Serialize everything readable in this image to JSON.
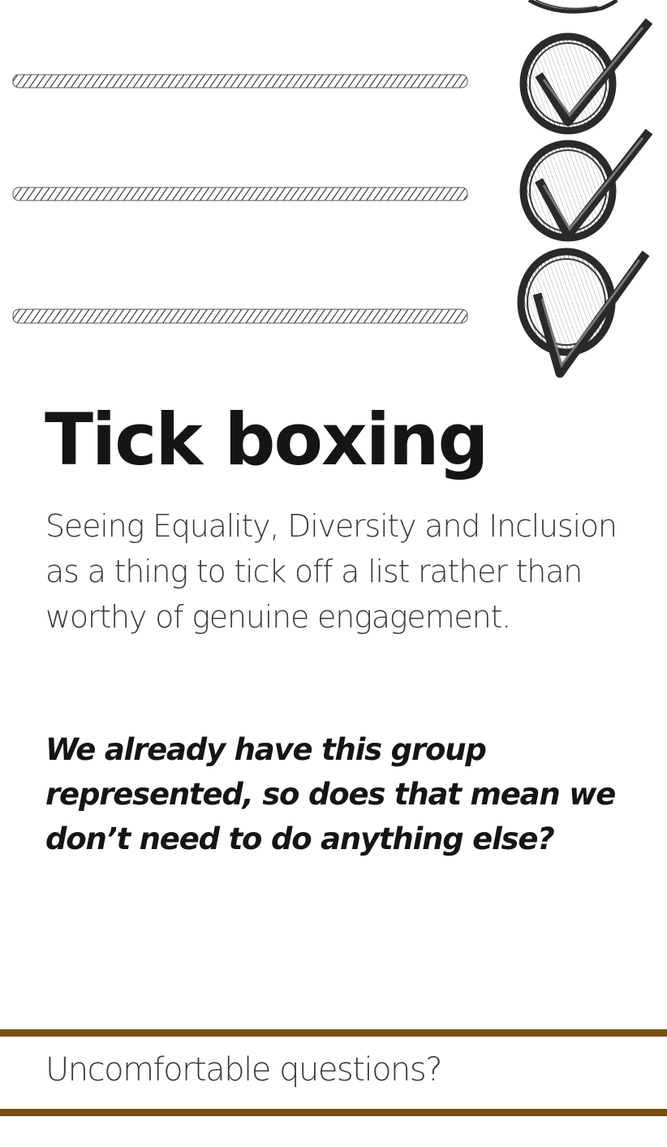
{
  "card": {
    "title": "Tick boxing",
    "description": "Seeing Equality, Diversity and Inclusion as a thing to tick off a list rather than worthy of genuine engagement.",
    "question": "We already have this group represented, so does that mean we don’t need to do anything else?",
    "footer": "Uncomfortable questions?"
  },
  "illustration": {
    "icons": [
      "hatched-line-icon",
      "checked-circle-icon"
    ],
    "rows": 3
  },
  "colors": {
    "accent_rule": "#7a4f12",
    "title_text": "#151515",
    "body_text": "#3a3a3a",
    "sketch_ink": "#2a2a2a"
  }
}
